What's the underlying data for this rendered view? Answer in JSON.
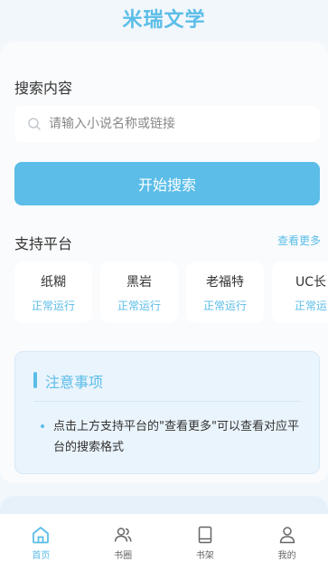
{
  "app": {
    "title": "米瑞文学"
  },
  "search": {
    "section_label": "搜索内容",
    "placeholder": "请输入小说名称或链接",
    "value": "",
    "button_label": "开始搜索"
  },
  "platforms": {
    "section_label": "支持平台",
    "more_label": "查看更多",
    "items": [
      {
        "name": "纸糊",
        "status": "正常运行"
      },
      {
        "name": "黑岩",
        "status": "正常运行"
      },
      {
        "name": "老福特",
        "status": "正常运行"
      },
      {
        "name": "UC长",
        "status": "正常运"
      }
    ]
  },
  "notice": {
    "title": "注意事项",
    "text": "点击上方支持平台的\"查看更多\"可以查看对应平台的搜索格式"
  },
  "tabbar": {
    "items": [
      {
        "label": "首页",
        "icon": "home-icon",
        "active": true
      },
      {
        "label": "书圈",
        "icon": "users-icon",
        "active": false
      },
      {
        "label": "书架",
        "icon": "book-icon",
        "active": false
      },
      {
        "label": "我的",
        "icon": "user-icon",
        "active": false
      }
    ]
  },
  "colors": {
    "accent": "#5bbde8",
    "background": "#f2f7fb"
  }
}
